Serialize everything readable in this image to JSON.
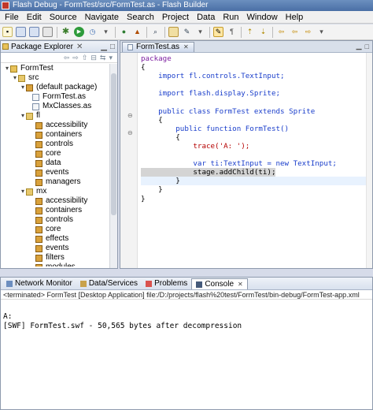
{
  "window": {
    "title": "Flash Debug - FormTest/src/FormTest.as - Flash Builder"
  },
  "menu": [
    "File",
    "Edit",
    "Source",
    "Navigate",
    "Search",
    "Project",
    "Data",
    "Run",
    "Window",
    "Help"
  ],
  "package_explorer": {
    "title": "Package Explorer",
    "tree": [
      {
        "label": "FormTest",
        "icon": "project-icon",
        "level": 0
      },
      {
        "label": "src",
        "icon": "source-folder-icon",
        "level": 1
      },
      {
        "label": "(default package)",
        "icon": "package-icon",
        "level": 2
      },
      {
        "label": "FormTest.as",
        "icon": "as-file-icon",
        "level": 3
      },
      {
        "label": "MxClasses.as",
        "icon": "as-file-icon",
        "level": 3
      },
      {
        "label": "fl",
        "icon": "library-folder-icon",
        "level": 2
      },
      {
        "label": "accessibility",
        "icon": "package-icon",
        "level": 3
      },
      {
        "label": "containers",
        "icon": "package-icon",
        "level": 3
      },
      {
        "label": "controls",
        "icon": "package-icon",
        "level": 3
      },
      {
        "label": "core",
        "icon": "package-icon",
        "level": 3
      },
      {
        "label": "data",
        "icon": "package-icon",
        "level": 3
      },
      {
        "label": "events",
        "icon": "package-icon",
        "level": 3
      },
      {
        "label": "managers",
        "icon": "package-icon",
        "level": 3
      },
      {
        "label": "mx",
        "icon": "library-folder-icon",
        "level": 2
      },
      {
        "label": "accessibility",
        "icon": "package-icon",
        "level": 3
      },
      {
        "label": "containers",
        "icon": "package-icon",
        "level": 3
      },
      {
        "label": "controls",
        "icon": "package-icon",
        "level": 3
      },
      {
        "label": "core",
        "icon": "package-icon",
        "level": 3
      },
      {
        "label": "effects",
        "icon": "package-icon",
        "level": 3
      },
      {
        "label": "events",
        "icon": "package-icon",
        "level": 3
      },
      {
        "label": "filters",
        "icon": "package-icon",
        "level": 3
      },
      {
        "label": "modules",
        "icon": "package-icon",
        "level": 3
      }
    ]
  },
  "editor": {
    "tab": "FormTest.as",
    "lines": [
      "package",
      "{",
      "    import fl.controls.TextInput;",
      "",
      "    import flash.display.Sprite;",
      "",
      "    public class FormTest extends Sprite",
      "    {",
      "        public function FormTest()",
      "        {",
      "            trace('A: ');",
      "",
      "            var ti:TextInput = new TextInput;",
      "            stage.addChild(ti);",
      "        }",
      "    }",
      "}"
    ]
  },
  "bottom_panel": {
    "tabs": [
      "Network Monitor",
      "Data/Services",
      "Problems",
      "Console"
    ],
    "active_tab": "Console",
    "status": "<terminated> FormTest [Desktop Application] file:/D:/projects/flash%20test/FormTest/bin-debug/FormTest-app.xml",
    "output": [
      "A:",
      "[SWF] FormTest.swf - 50,565 bytes after decompression"
    ]
  }
}
